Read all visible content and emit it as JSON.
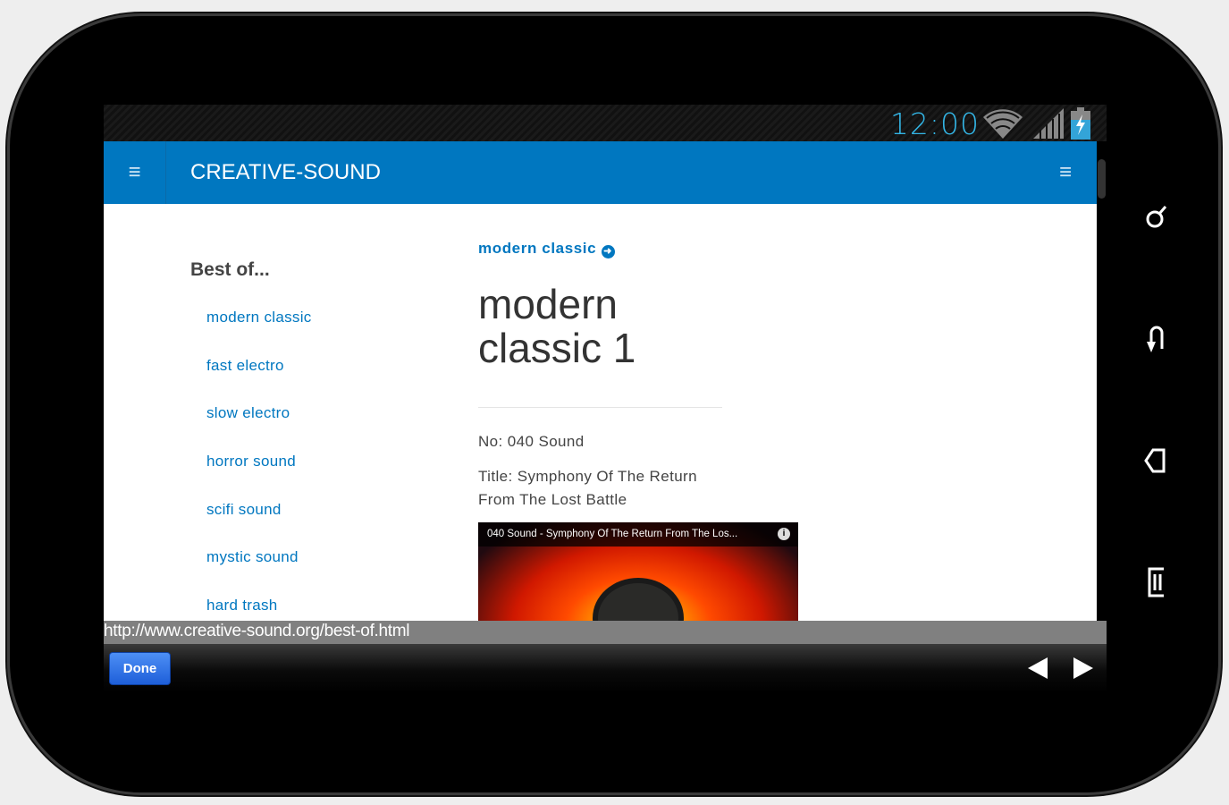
{
  "status": {
    "time": "12:00"
  },
  "header": {
    "title": "CREATIVE-SOUND"
  },
  "sidebar": {
    "heading": "Best of...",
    "items": [
      {
        "label": "modern classic"
      },
      {
        "label": "fast electro"
      },
      {
        "label": "slow electro"
      },
      {
        "label": "horror sound"
      },
      {
        "label": "scifi sound"
      },
      {
        "label": "mystic sound"
      },
      {
        "label": "hard trash"
      }
    ]
  },
  "main": {
    "breadcrumb": "modern classic",
    "title": "modern classic 1",
    "number": "No: 040 Sound",
    "track_title": "Title: Symphony Of The Return From The Lost Battle",
    "video_title": "040 Sound - Symphony Of The Return From The Los..."
  },
  "browser": {
    "url": "http://www.creative-sound.org/best-of.html",
    "done_label": "Done"
  },
  "colors": {
    "brand": "#0077c0",
    "clock": "#33b5e5"
  }
}
